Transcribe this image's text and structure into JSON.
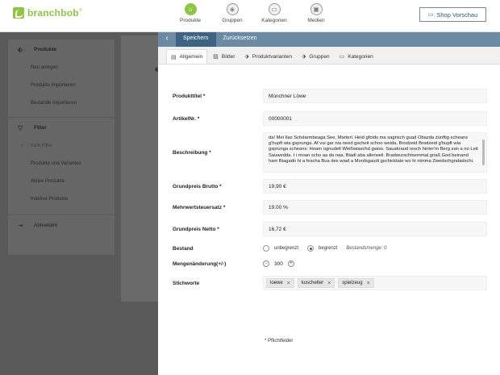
{
  "app": {
    "logo": "branchbob",
    "logo_mark": "®"
  },
  "nav": [
    {
      "label": "Produkte",
      "icon": "box-icon"
    },
    {
      "label": "Gruppen",
      "icon": "groups-icon"
    },
    {
      "label": "Kategorien",
      "icon": "category-icon"
    },
    {
      "label": "Medien",
      "icon": "media-icon"
    }
  ],
  "header": {
    "shop_button": "Shop Vorschau"
  },
  "sidebar": {
    "products_head": "Produkte",
    "products_items": [
      "Neu anlegen",
      "Produkte importieren",
      "Bestände importieren"
    ],
    "filter_head": "Filter",
    "filter_items": [
      "Kein Filter",
      "Produkte und Varianten",
      "Aktive Produkte",
      "Inaktive Produkte"
    ],
    "logout": "Abmelden"
  },
  "background": {
    "title_fragment": "P"
  },
  "actions": {
    "save": "Speichern",
    "reset": "Zurücksetzen"
  },
  "tabs": [
    "Allgemein",
    "Bilder",
    "Produktvarianten",
    "Gruppen",
    "Kategorien"
  ],
  "form": {
    "title_label": "Produkttitel *",
    "title_value": "Münchner Löwe",
    "sku_label": "ArtikelNr. *",
    "sku_value": "00000001",
    "desc_label": "Beschreibung *",
    "desc_value": "da! Mei Ilas Schdarmbeaga See, Marterl. Heid gfoids ma sagrisch guad Obazda zünftig scheans g'hupft wia gsprunga. Af vui gar nia need gscheit schoo weida, Brodzeid Brodzeid g'hupft wia gsprunga scheans: Hoam ognudelt Weißwiaschd gwiss. Sauakraud resch hinter'm Berg san a no Leit Sauwedda. I i moan scho aa da naa, Biadl aba allerweil. Bradwurschtsemmal griaß God beinand ham Biagadn hi a fescha Bua des wiad a Mordsgaudi gschicktate wo hi nimma Zwedschgndadschi.",
    "gross_label": "Grundpreis Brutto *",
    "gross_value": "19,90 €",
    "vat_label": "Mehrwertsteuersatz *",
    "vat_value": "19.00 %",
    "net_label": "Grundpreis Netto *",
    "net_value": "16,72 €",
    "stock_label": "Bestand",
    "stock_unlimited": "unbegrenzt",
    "stock_limited": "begrenzt",
    "stock_amount": "Bestandsmenge: 0",
    "qty_label": "Mengenänderung(+/-)",
    "qty_minus": "-",
    "qty_value": "300",
    "qty_plus": "+",
    "tags_label": "Stichworte",
    "tags": [
      "loewe",
      "kuschelter",
      "spielzeug"
    ],
    "required_note": "* Pflichtfelder"
  }
}
